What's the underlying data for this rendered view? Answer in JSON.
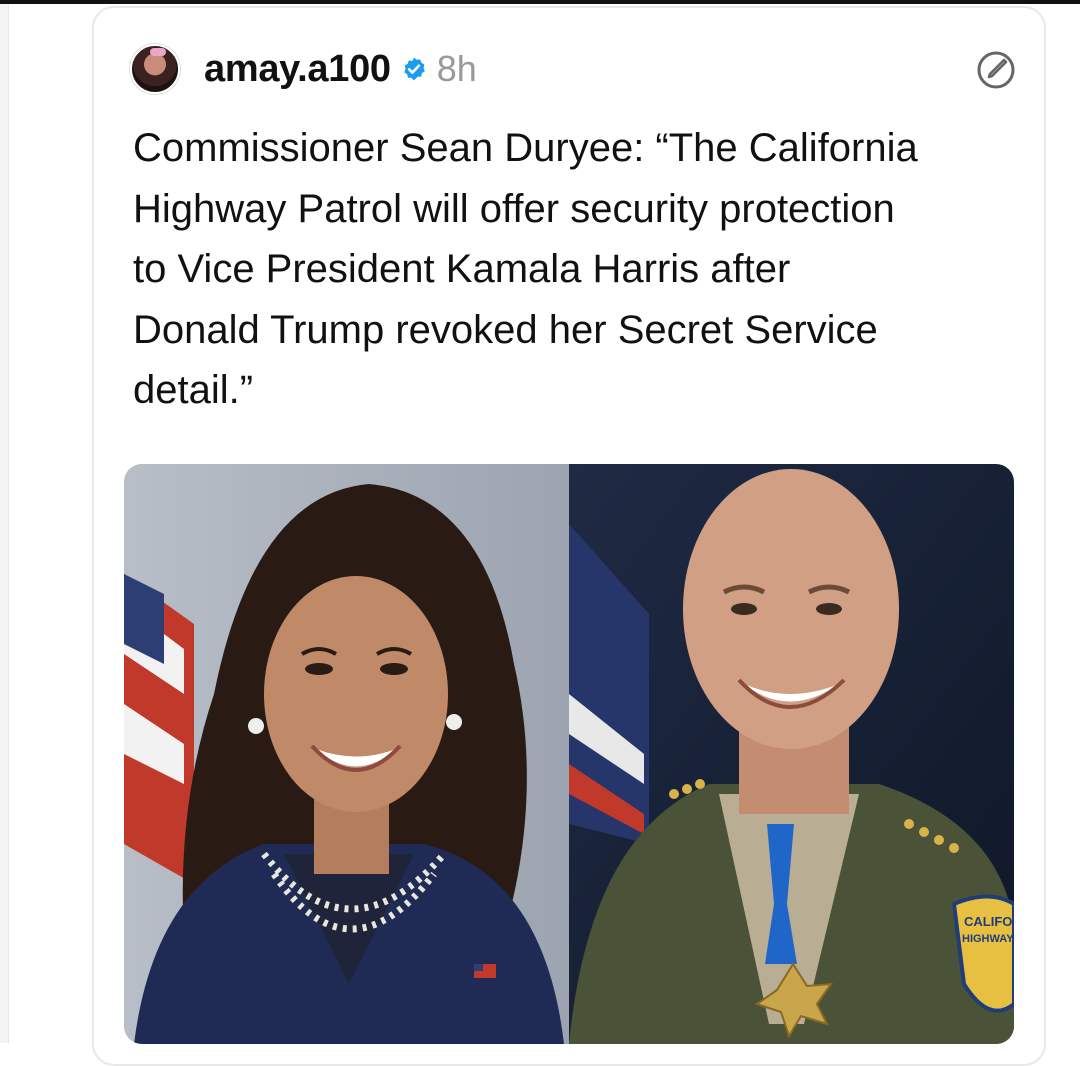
{
  "post": {
    "username": "amay.a100",
    "time": "8h",
    "text": "Commissioner Sean Duryee: “The California\nHighway Patrol will offer security protection\nto Vice President Kamala Harris after\nDonald Trump revoked her Secret Service\ndetail.”"
  },
  "icons": {
    "verified": "verified-badge-icon",
    "edit": "edit-icon"
  },
  "colors": {
    "verified": "#1d9bf0",
    "text": "#111111",
    "muted": "#999999"
  },
  "photos": {
    "right_patch": "CALIFO HIGHWAY"
  }
}
